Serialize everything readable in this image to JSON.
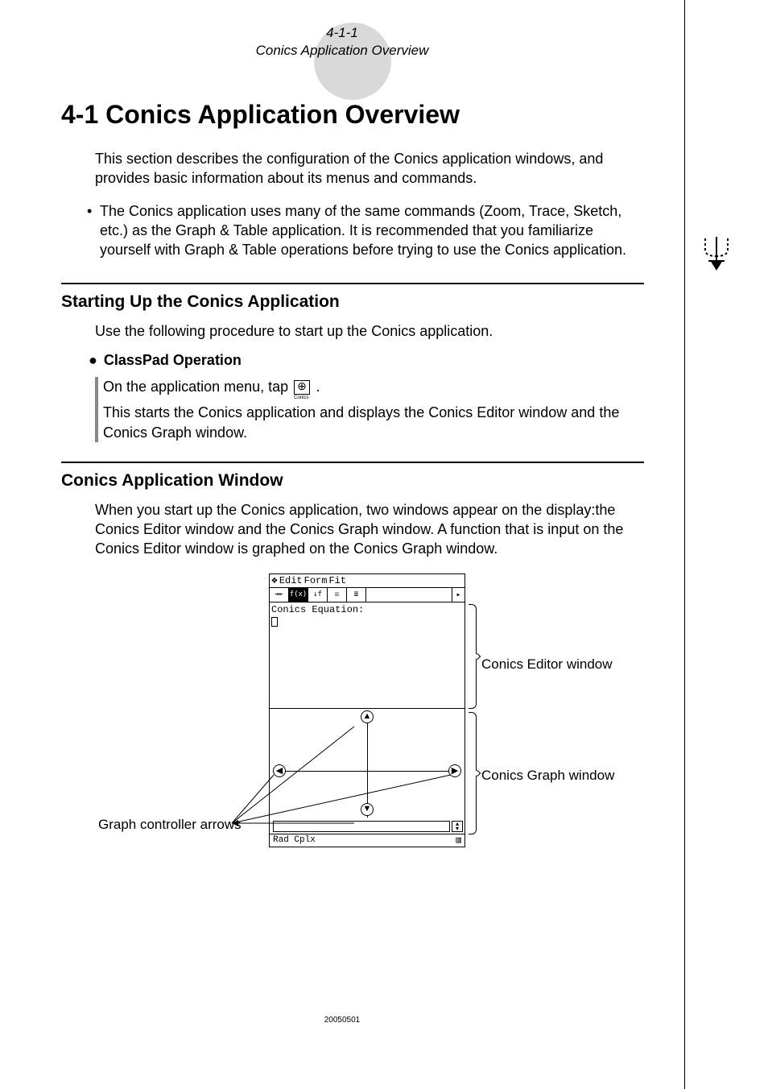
{
  "header": {
    "page_ref": "4-1-1",
    "page_subtitle": "Conics Application Overview"
  },
  "title": "4-1 Conics Application Overview",
  "intro": "This section describes the configuration of the Conics application windows, and provides basic information about its menus and commands.",
  "bullet1": "The Conics application uses many of the same commands (Zoom, Trace, Sketch, etc.) as the Graph & Table application. It is recommended that you familiarize yourself with Graph & Table operations before trying to use the Conics application.",
  "section_start": {
    "heading": "Starting Up the Conics Application",
    "para": "Use the following procedure to start up the Conics application.",
    "classpad_label": "ClassPad Operation",
    "op_line1_a": "On the application menu, tap ",
    "op_line1_b": ".",
    "icon_label": "Conics",
    "op_line2": "This starts the Conics application and displays the Conics Editor window and the Conics Graph window."
  },
  "section_window": {
    "heading": "Conics Application Window",
    "para": "When you start up the Conics application, two windows appear on the display:the Conics Editor window and the Conics Graph window. A function that is input on the Conics Editor window is graphed on the Conics Graph window."
  },
  "figure": {
    "menubar": {
      "items": [
        "Edit",
        "Form",
        "Fit"
      ]
    },
    "editor_title": "Conics Equation:",
    "status": {
      "left": "Rad  Cplx",
      "battery": "▥"
    },
    "callouts": {
      "editor": "Conics Editor window",
      "graph": "Conics Graph window",
      "controller": "Graph controller arrows"
    }
  },
  "footer_code": "20050501"
}
